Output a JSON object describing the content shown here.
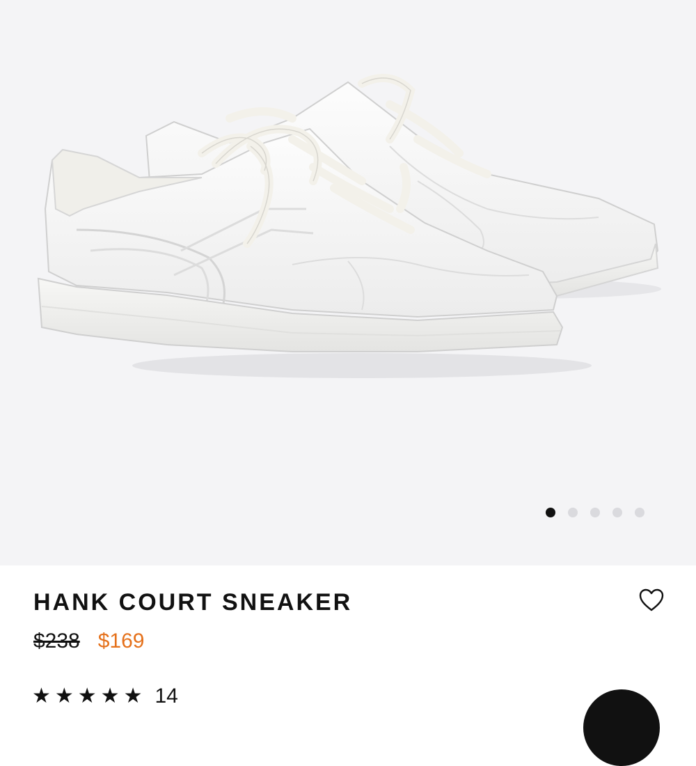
{
  "product": {
    "name": "HANK COURT SNEAKER",
    "original_price": "$238",
    "sale_price": "$169",
    "rating_stars": "★★★★★",
    "review_count": "14"
  },
  "gallery": {
    "image_count": 5,
    "active_index": 0,
    "image_subject": "white-leather-sneakers"
  },
  "colors": {
    "sale_price": "#e5711b",
    "hero_background": "#f4f4f6",
    "dot_active": "#111111",
    "dot_inactive": "#dadade"
  },
  "icons": {
    "wishlist": "heart-outline-icon"
  }
}
